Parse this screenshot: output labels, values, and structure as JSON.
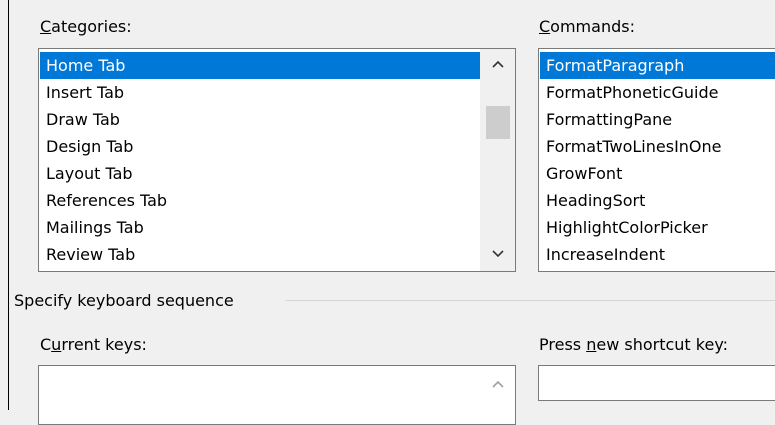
{
  "categories": {
    "label_pre": "",
    "label_accel": "C",
    "label_post": "ategories:",
    "items": [
      {
        "label": "Home Tab",
        "selected": true
      },
      {
        "label": "Insert Tab",
        "selected": false
      },
      {
        "label": "Draw Tab",
        "selected": false
      },
      {
        "label": "Design Tab",
        "selected": false
      },
      {
        "label": "Layout Tab",
        "selected": false
      },
      {
        "label": "References Tab",
        "selected": false
      },
      {
        "label": "Mailings Tab",
        "selected": false
      },
      {
        "label": "Review Tab",
        "selected": false
      }
    ]
  },
  "commands": {
    "label_pre": "",
    "label_accel": "C",
    "label_post": "ommands:",
    "items": [
      {
        "label": "FormatParagraph",
        "selected": true
      },
      {
        "label": "FormatPhoneticGuide",
        "selected": false
      },
      {
        "label": "FormattingPane",
        "selected": false
      },
      {
        "label": "FormatTwoLinesInOne",
        "selected": false
      },
      {
        "label": "GrowFont",
        "selected": false
      },
      {
        "label": "HeadingSort",
        "selected": false
      },
      {
        "label": "HighlightColorPicker",
        "selected": false
      },
      {
        "label": "IncreaseIndent",
        "selected": false
      }
    ]
  },
  "keyboard": {
    "group_label": "Specify keyboard sequence",
    "current_keys_pre": "C",
    "current_keys_accel": "u",
    "current_keys_post": "rrent keys:",
    "press_new_pre": "Press ",
    "press_new_accel": "n",
    "press_new_post": "ew shortcut key:",
    "new_shortcut_value": ""
  },
  "icons": {
    "up": "▲",
    "down": "▼",
    "chev_up": "⌃",
    "chev_down": "⌄"
  },
  "colors": {
    "selection": "#0078d7",
    "background": "#f0f0f0"
  }
}
